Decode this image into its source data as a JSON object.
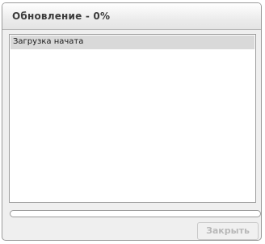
{
  "dialog": {
    "title": "Обновление - 0%",
    "log": {
      "lines": [
        "Загрузка начата"
      ]
    },
    "progress": {
      "value": 0
    },
    "close_button": {
      "label": "Закрыть",
      "enabled": false
    }
  }
}
